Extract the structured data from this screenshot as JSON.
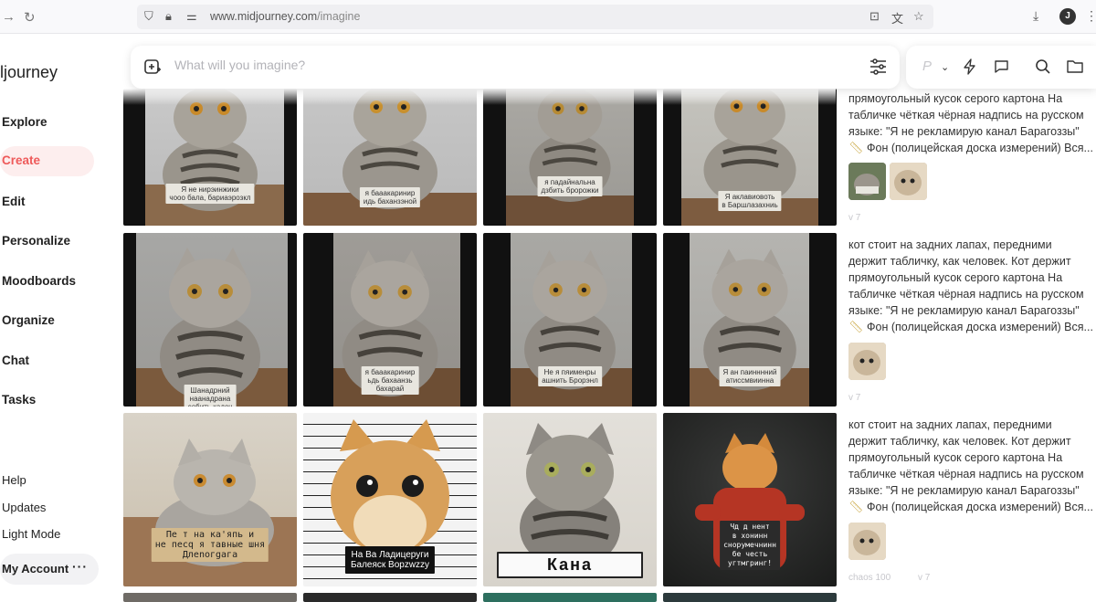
{
  "browser": {
    "url_domain": "www.midjourney.com",
    "url_path": "/imagine",
    "profile_initial": "J"
  },
  "sidebar": {
    "brand": "ljourney",
    "items": [
      {
        "label": "Explore"
      },
      {
        "label": "Create",
        "active": true
      },
      {
        "label": "Edit"
      },
      {
        "label": "Personalize"
      },
      {
        "label": "Moodboards"
      },
      {
        "label": "Organize"
      },
      {
        "label": "Chat"
      },
      {
        "label": "Tasks"
      }
    ],
    "footer": [
      {
        "label": "Help"
      },
      {
        "label": "Updates"
      },
      {
        "label": "Light Mode"
      }
    ],
    "account": "My Account",
    "account_more": "···"
  },
  "search": {
    "placeholder": "What will you imagine?"
  },
  "tools": {
    "p_label": "P"
  },
  "grid": {
    "row1": [
      {
        "sign": "Я не нирэинжики\nчооо бала, бариаэрозкл"
      },
      {
        "sign": "я бааакаринир\nидь баханзэной"
      },
      {
        "sign": "я падайнальна\nдзбить бророжки"
      },
      {
        "sign": "Я аклавиовоть\nв Баршлазахниь"
      }
    ],
    "row2": [
      {
        "sign": "Шанадрний\nнаанадрана\nсобить кадеч"
      },
      {
        "sign": "я бааакаринир\nьдь бахаанзь\nбахарай"
      },
      {
        "sign": "Не я пяименры\nашнить Брорэнл"
      },
      {
        "sign": "Я ан паинннний\nатиссмвиинна"
      }
    ],
    "row3": [
      {
        "sign": "Пе т на ка'япь и\nне песq я тавные шня\nДлеnогgaга"
      },
      {
        "sign": "На Ва Ладицеруги\nБалеяск Bopzwzzy"
      },
      {
        "sign": "Кана"
      },
      {
        "sign": "Чд д нент\nв хонинн\nснорумечнинн\nбе честь\nугтмгринг!"
      }
    ]
  },
  "prompts": [
    {
      "text": "прямоугольный кусок серого картона На табличке чёткая чёрная надпись на русском языке: \"Я не рекламирую канал Барагоззы\"",
      "text_tail": "Фон (полицейская доска измерений) Вся...",
      "version": "v 7"
    },
    {
      "text": "кот стоит на задних лапах, передними держит табличку, как человек. Кот держит прямоугольный кусок серого картона На табличке чёткая чёрная надпись на русском языке: \"Я не рекламирую канал Барагоззы\"",
      "text_tail": "Фон (полицейская доска измерений) Вся...",
      "version": "v 7"
    },
    {
      "text": "кот стоит на задних лапах, передними держит табличку, как человек. Кот держит прямоугольный кусок серого картона На табличке чёткая чёрная надпись на русском языке: \"Я не рекламирую канал Барагоззы\"",
      "text_tail": "Фон (полицейская доска измерений) Вся...",
      "chaos": "chaos 100",
      "version": "v 7"
    }
  ],
  "colors": {
    "accent": "#ee5a5a",
    "accent_bg": "#fdeeee"
  }
}
